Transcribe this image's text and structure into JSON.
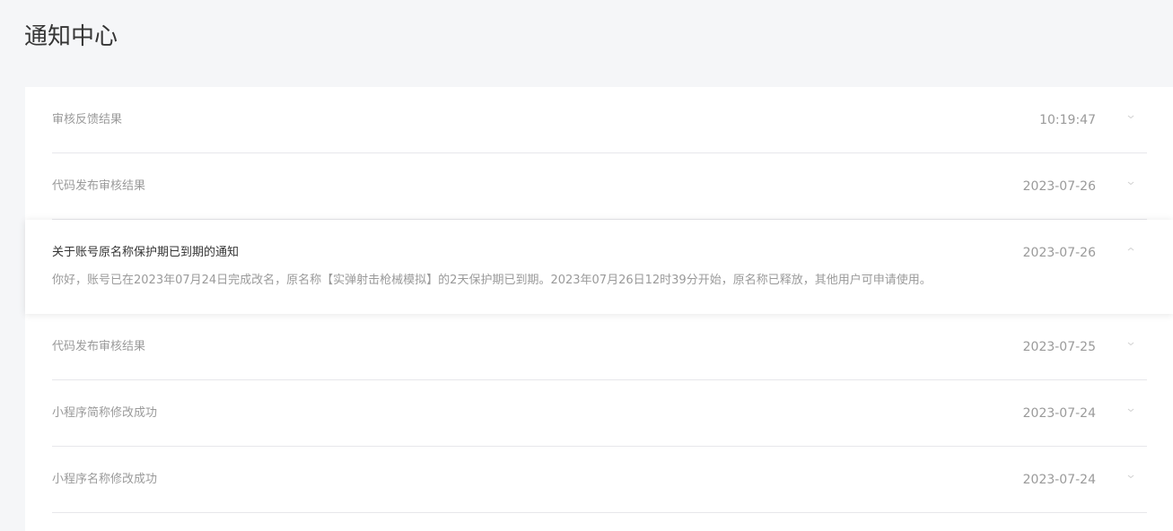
{
  "page": {
    "title": "通知中心"
  },
  "notifications": [
    {
      "title": "审核反馈结果",
      "time": "10:19:47",
      "arrow_icon": "chevron-down-icon"
    },
    {
      "title": "代码发布审核结果",
      "time": "2023-07-26",
      "arrow_icon": "chevron-down-icon"
    },
    {
      "title": "关于账号原名称保护期已到期的通知",
      "time": "2023-07-26",
      "arrow_icon": "chevron-up-icon",
      "content": "你好，账号已在2023年07月24日完成改名，原名称【实弹射击枪械模拟】的2天保护期已到期。2023年07月26日12时39分开始，原名称已释放，其他用户可申请使用。"
    },
    {
      "title": "代码发布审核结果",
      "time": "2023-07-25",
      "arrow_icon": "chevron-down-icon"
    },
    {
      "title": "小程序简称修改成功",
      "time": "2023-07-24",
      "arrow_icon": "chevron-down-icon"
    },
    {
      "title": "小程序名称修改成功",
      "time": "2023-07-24",
      "arrow_icon": "chevron-down-icon"
    }
  ],
  "colors": {
    "background": "#f5f6f8",
    "panel": "#ffffff",
    "text_muted": "#9a9a9a",
    "text_primary": "#353535",
    "divider": "#e7e7eb"
  }
}
